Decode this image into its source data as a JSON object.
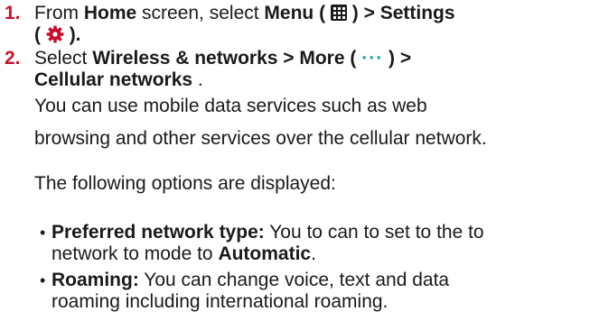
{
  "step1": {
    "number": "1.",
    "a": "From ",
    "b_home": "Home",
    "c": " screen, select ",
    "d_menu": "Menu (",
    "e_close1": ") > Settings",
    "f_open2": "(",
    "g_close2": ")."
  },
  "step2": {
    "number": "2.",
    "a": "Select ",
    "b_path": "Wireless & networks > More (",
    "c_dots": "···",
    "d_close": ") >",
    "e_cell": "Cellular networks",
    "f_period": " ."
  },
  "body": {
    "p1_line1": "You can use mobile data services such as web",
    "p1_line2": "browsing and other services over the cellular network.",
    "p2": "The following options are displayed:"
  },
  "bullets": [
    {
      "label": "Preferred network type:",
      "text1": " You to can to set to the to",
      "text2a": "network to mode to ",
      "text2b": "Automatic",
      "text2c": "."
    },
    {
      "label": "Roaming:",
      "text1": " You can change voice, text and data",
      "text2": "roaming including international roaming."
    }
  ],
  "colors": {
    "step_number": "#c8102e",
    "more_dots": "#14a39b",
    "gear_icon": "#c8102e"
  }
}
